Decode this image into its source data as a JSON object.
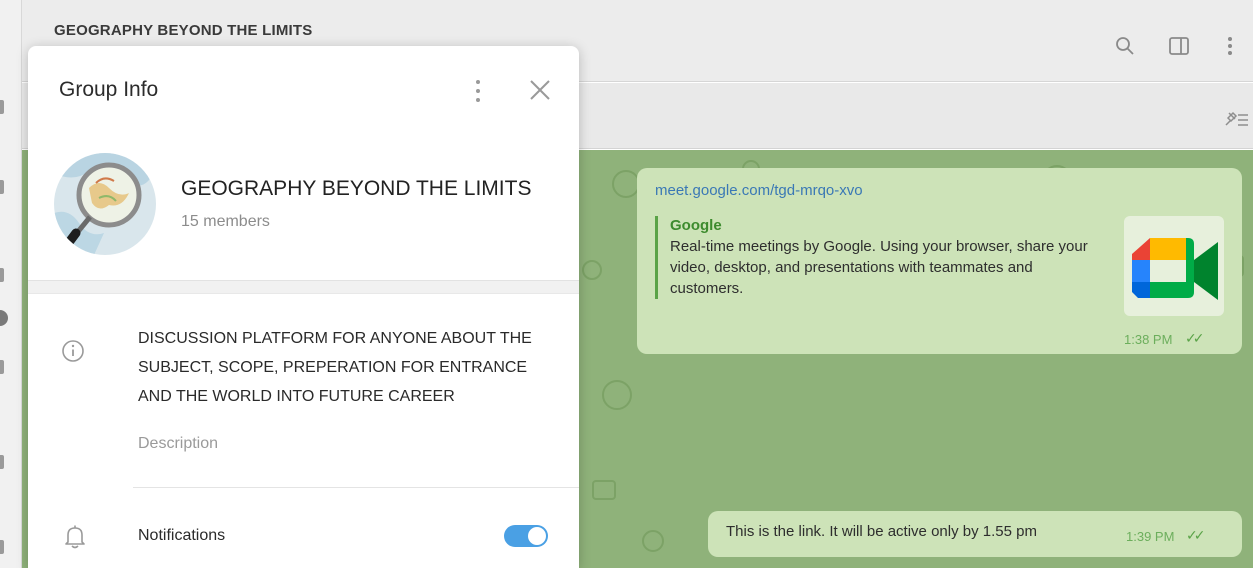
{
  "chat": {
    "title": "GEOGRAPHY BEYOND THE LIMITS",
    "header_icons": [
      "search-icon",
      "sidebar-toggle-icon",
      "more-vertical-icon"
    ],
    "pinned_icon": "pinned-list-icon",
    "messages": [
      {
        "type": "link",
        "url": "meet.google.com/tgd-mrqo-xvo",
        "preview_site": "Google",
        "preview_description": "Real-time meetings by Google. Using your browser, share your video, desktop, and presentations with teammates and customers.",
        "thumbnail": "google-meet-logo",
        "time": "1:38 PM",
        "status": "read"
      },
      {
        "type": "text",
        "text": "This is the link. It will be active only by 1.55 pm",
        "time": "1:39 PM",
        "status": "read"
      }
    ]
  },
  "group_info": {
    "title": "Group Info",
    "name": "GEOGRAPHY BEYOND THE LIMITS",
    "members": "15 members",
    "description": "DISCUSSION PLATFORM FOR ANYONE ABOUT THE SUBJECT, SCOPE, PREPERATION FOR ENTRANCE AND THE WORLD INTO FUTURE CAREER",
    "description_label": "Description",
    "notifications_label": "Notifications",
    "notifications_enabled": true
  },
  "colors": {
    "accent": "#4aa0e4",
    "chat_background": "#8fb27a",
    "bubble": "#cde3b8",
    "link": "#3a78b5",
    "preview_bar": "#5aa347"
  }
}
